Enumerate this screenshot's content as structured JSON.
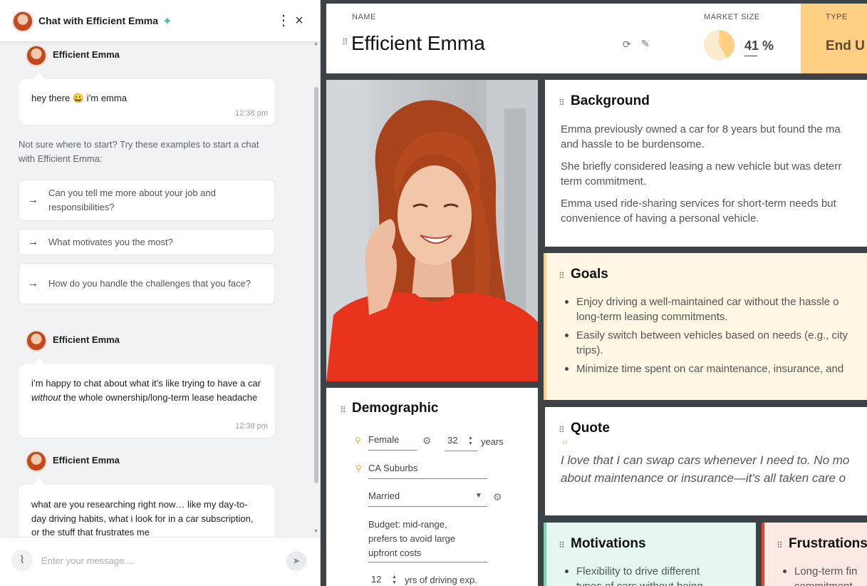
{
  "chat": {
    "title": "Chat with Efficient Emma",
    "sparkle_icon": "sparkle-icon",
    "more_icon": "⋮",
    "close_icon": "×",
    "messages": [
      {
        "sender": "Efficient Emma",
        "text": "hey there 😀 i’m emma",
        "time": "12:38 pm"
      },
      {
        "sender": "Efficient Emma",
        "text_before": "i’m happy to chat about what it’s like trying to have a car ",
        "text_em": "without",
        "text_after": " the whole ownership/long-term lease headache",
        "time": "12:38 pm"
      },
      {
        "sender": "Efficient Emma",
        "text": "what are you researching right now… like my day-to-day driving habits, what i look for in a car subscription, or the stuff that frustrates me"
      }
    ],
    "hint": "Not sure where to start? Try these examples to start a chat with Efficient Emma:",
    "suggestions": [
      "Can you tell me more about your job and responsibilities?",
      "What motivates you the most?",
      "How do you handle the challenges that you face?"
    ],
    "input_placeholder": "Enter your message...."
  },
  "persona": {
    "name_label": "NAME",
    "name": "Efficient Emma",
    "market_label": "MARKET SIZE",
    "market_value": "41",
    "market_unit": "%",
    "market_fraction": 0.41,
    "type_label": "TYPE",
    "type_value": "End U",
    "accent_color": "#ffcf84"
  },
  "background": {
    "title": "Background",
    "paragraphs": [
      [
        "Emma previously owned a car for 8 years but found the ma",
        "and hassle to be burdensome."
      ],
      [
        "She briefly considered leasing a new vehicle but was deterr",
        "term commitment."
      ],
      [
        "Emma used ride-sharing services for short-term needs but",
        "convenience of having a personal vehicle."
      ]
    ]
  },
  "goals": {
    "title": "Goals",
    "items": [
      [
        "Enjoy driving a well-maintained car without the hassle o",
        "long-term leasing commitments."
      ],
      [
        "Easily switch between vehicles based on needs (e.g., city",
        "trips)."
      ],
      [
        "Minimize time spent on car maintenance, insurance, and"
      ]
    ]
  },
  "quote": {
    "title": "Quote",
    "lines": [
      "I love that I can swap cars whenever I need to. No mo",
      "about maintenance or insurance—it's all taken care o"
    ]
  },
  "motivations": {
    "title": "Motivations",
    "items": [
      "Flexibility to drive different",
      "types of cars without being"
    ]
  },
  "frustrations": {
    "title": "Frustrations",
    "items": [
      "Long-term fin",
      "commitment"
    ]
  },
  "demographic": {
    "title": "Demographic",
    "gender": "Female",
    "age": "32",
    "age_unit": "years",
    "location": "CA Suburbs",
    "marital": "Married",
    "budget_lines": [
      "Budget: mid-range,",
      "prefers to avoid large",
      "upfront costs"
    ],
    "driving_years": "12",
    "driving_unit": "yrs of driving exp."
  }
}
